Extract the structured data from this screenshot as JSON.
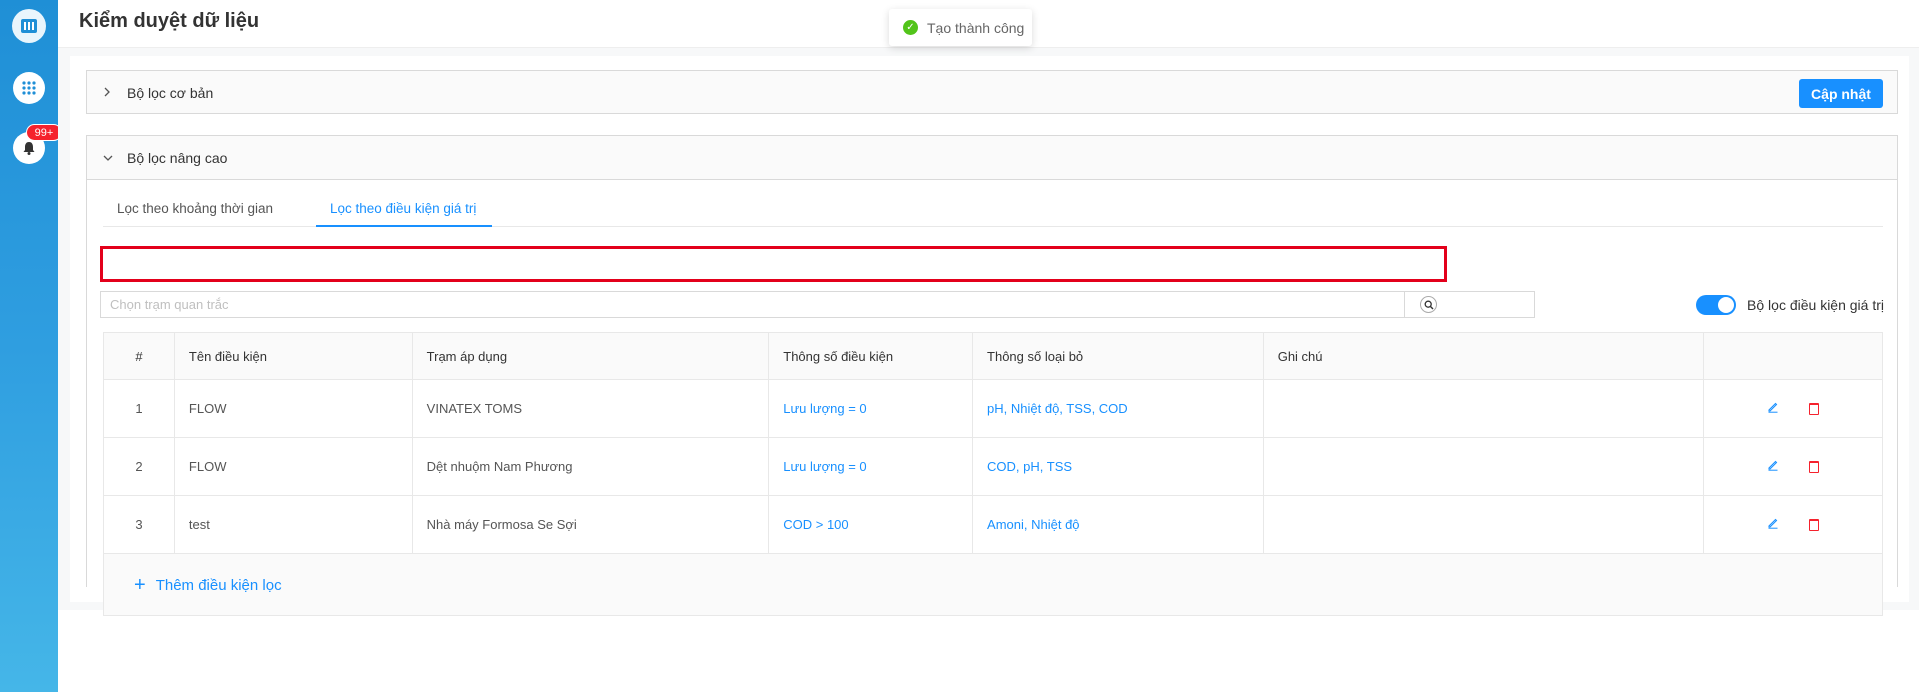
{
  "header": {
    "title": "Kiểm duyệt dữ liệu"
  },
  "sidebar": {
    "badge": "99+"
  },
  "toast": {
    "message": "Tạo thành công"
  },
  "basic_filter": {
    "title": "Bộ lọc cơ bản",
    "update_label": "Cập nhật"
  },
  "advanced_filter": {
    "title": "Bộ lọc nâng cao",
    "tabs": [
      {
        "label": "Lọc theo khoảng thời gian",
        "active": false
      },
      {
        "label": "Lọc theo điều kiện giá trị",
        "active": true
      }
    ],
    "search": {
      "placeholder": "Chọn trạm quan trắc",
      "value": ""
    },
    "toggle_label": "Bộ lọc điều kiện giá trị",
    "toggle_on": true,
    "table": {
      "columns": [
        "#",
        "Tên điều kiện",
        "Trạm áp dụng",
        "Thông số điều kiện",
        "Thông số loại bỏ",
        "Ghi chú",
        ""
      ],
      "rows": [
        {
          "index": "1",
          "name": "FLOW",
          "station": "VINATEX TOMS",
          "condition": "Lưu lượng = 0",
          "excluded": "pH, Nhiệt độ, TSS, COD",
          "note": ""
        },
        {
          "index": "2",
          "name": "FLOW",
          "station": "Dệt nhuộm Nam Phương",
          "condition": "Lưu lượng = 0",
          "excluded": "COD, pH, TSS",
          "note": ""
        },
        {
          "index": "3",
          "name": "test",
          "station": "Nhà máy Formosa Se Sợi",
          "condition": "COD > 100",
          "excluded": "Amoni, Nhiệt độ",
          "note": ""
        }
      ]
    },
    "add_label": "Thêm điều kiện lọc"
  },
  "colors": {
    "primary": "#1890ff",
    "danger": "#f5222d",
    "success": "#52c41a",
    "sidebar": "#2f9ee0"
  }
}
